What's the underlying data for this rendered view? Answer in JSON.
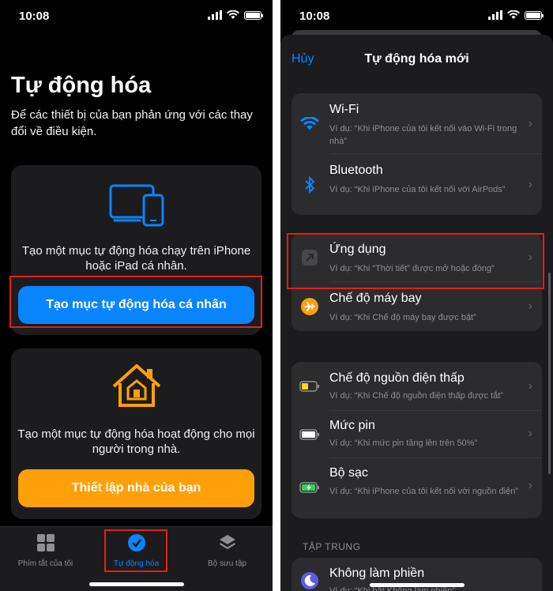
{
  "left": {
    "status_time": "10:08",
    "title": "Tự động hóa",
    "subtitle": "Để các thiết bị của bạn phản ứng với các thay đổi về điều kiện.",
    "personal_card": {
      "text": "Tạo một mục tự động hóa chạy trên iPhone hoặc iPad cá nhân.",
      "button": "Tạo mục tự động hóa cá nhân"
    },
    "home_card": {
      "text": "Tạo một mục tự động hóa hoạt động cho mọi người trong nhà.",
      "button": "Thiết lập nhà của bạn"
    },
    "tabs": [
      {
        "label": "Phím tắt của tôi",
        "icon": "grid-icon"
      },
      {
        "label": "Tự động hóa",
        "icon": "clock-check-icon"
      },
      {
        "label": "Bộ sưu tập",
        "icon": "layers-icon"
      }
    ],
    "colors": {
      "accent": "#0a84ff",
      "home": "#ff9f0a",
      "highlight": "#e0201b"
    }
  },
  "right": {
    "status_time": "10:08",
    "nav": {
      "cancel": "Hủy",
      "title": "Tự động hóa mới"
    },
    "group1": [
      {
        "title": "Wi-Fi",
        "subtitle": "Ví dụ: “Khi iPhone của tôi kết nối vào Wi-Fi trong nhà”",
        "icon": "wifi-icon"
      },
      {
        "title": "Bluetooth",
        "subtitle": "Ví dụ: “Khi iPhone của tôi kết nối với AirPods”",
        "icon": "bluetooth-icon"
      }
    ],
    "group2": [
      {
        "title": "Ứng dụng",
        "subtitle": "Ví dụ: “Khi “Thời tiết” được mở hoặc đóng”",
        "icon": "app-icon"
      },
      {
        "title": "Chế độ máy bay",
        "subtitle": "Ví dụ: “Khi Chế độ máy bay được bật”",
        "icon": "airplane-icon"
      }
    ],
    "group3": [
      {
        "title": "Chế độ nguồn điện thấp",
        "subtitle": "Ví dụ: “Khi Chế độ nguồn điện thấp được tắt”",
        "icon": "low-battery-icon"
      },
      {
        "title": "Mức pin",
        "subtitle": "Ví dụ: “Khi mức pin tăng lên trên 50%”",
        "icon": "battery-icon"
      },
      {
        "title": "Bộ sạc",
        "subtitle": "Ví dụ: “Khi iPhone của tôi kết nối với nguồn điện”",
        "icon": "charging-icon"
      }
    ],
    "section_focus": "TẬP TRUNG",
    "group4": [
      {
        "title": "Không làm phiền",
        "subtitle": "Ví dụ: “Khi bật Không làm phiền”",
        "icon": "moon-icon"
      }
    ]
  }
}
